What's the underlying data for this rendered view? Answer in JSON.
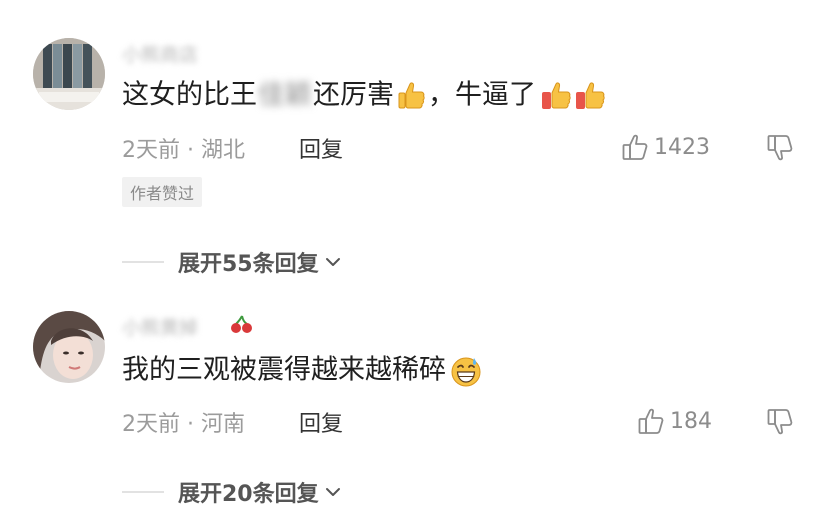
{
  "comments": [
    {
      "username": "小熊商店",
      "text_before": "这女的比王",
      "blurred_name": "佳颖",
      "text_mid": "还厉害",
      "text_after": "，牛逼了",
      "meta": "2天前 · 湖北",
      "reply_label": "回复",
      "like_count": "1423",
      "badge": "作者赞过",
      "expand_label": "展开55条回复"
    },
    {
      "username": "小熊黄掉",
      "text": "我的三观被震得越来越稀碎",
      "meta": "2天前 · 河南",
      "reply_label": "回复",
      "like_count": "184",
      "expand_label": "展开20条回复"
    }
  ],
  "icons": {
    "like": "thumbs-up-outline-icon",
    "dislike": "thumbs-down-outline-icon",
    "emoji_thumb": "thumbs-up-emoji-icon",
    "emoji_grin": "grinning-sweat-emoji-icon",
    "expand": "chevron-down-icon"
  }
}
